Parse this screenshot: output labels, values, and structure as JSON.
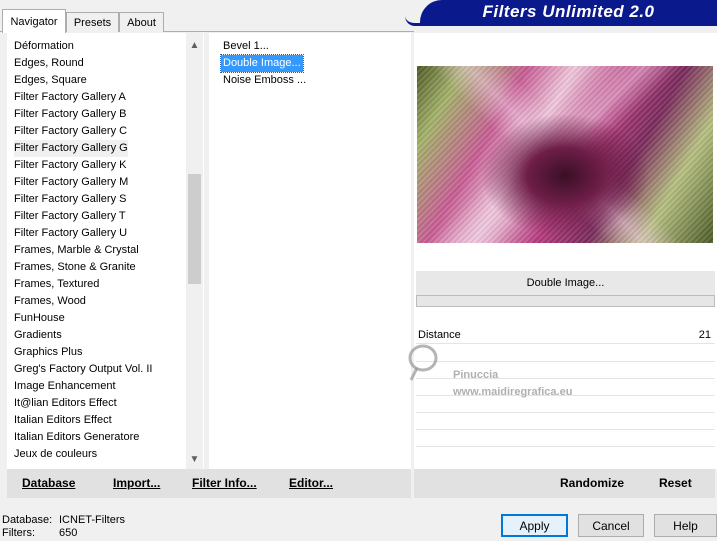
{
  "tabs": [
    {
      "label": "Navigator",
      "active": true
    },
    {
      "label": "Presets",
      "active": false
    },
    {
      "label": "About",
      "active": false
    }
  ],
  "header": {
    "title": "Filters Unlimited 2.0",
    "color": "#0a1a8c"
  },
  "categories": [
    "Déformation",
    "Edges, Round",
    "Edges, Square",
    "Filter Factory Gallery A",
    "Filter Factory Gallery B",
    "Filter Factory Gallery C",
    "Filter Factory Gallery G",
    "Filter Factory Gallery K",
    "Filter Factory Gallery M",
    "Filter Factory Gallery S",
    "Filter Factory Gallery T",
    "Filter Factory Gallery U",
    "Frames, Marble & Crystal",
    "Frames, Stone & Granite",
    "Frames, Textured",
    "Frames, Wood",
    "FunHouse",
    "Gradients",
    "Graphics Plus",
    "Greg's Factory Output Vol. II",
    "Image Enhancement",
    "It@lian Editors Effect",
    "Italian Editors Effect",
    "Italian Editors Generatore",
    "Jeux de couleurs"
  ],
  "selected_category": "Filter Factory Gallery G",
  "filters": {
    "items": [
      "Bevel 1...",
      "Double Image...",
      "Noise Emboss ..."
    ],
    "selected": "Double Image..."
  },
  "preview": {
    "filter_name": "Double Image...",
    "params": [
      {
        "label": "Distance",
        "value": "21"
      }
    ]
  },
  "toolbar": {
    "database": "Database",
    "import": "Import...",
    "filter_info": "Filter Info...",
    "editor": "Editor...",
    "randomize": "Randomize",
    "reset": "Reset"
  },
  "footer": {
    "database_label": "Database:",
    "database_value": "ICNET-Filters",
    "filters_label": "Filters:",
    "filters_value": "650"
  },
  "buttons": {
    "apply": "Apply",
    "cancel": "Cancel",
    "help": "Help"
  },
  "watermark": {
    "line1": "Pinuccia",
    "line2": "www.maidiregrafica.eu"
  },
  "colors": {
    "selection": "#3399ff",
    "focus_border": "#0078d7"
  }
}
